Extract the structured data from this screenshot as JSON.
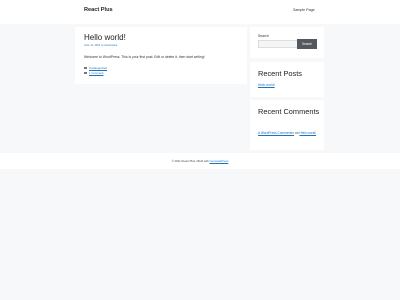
{
  "header": {
    "brand": "React Plus",
    "nav": [
      {
        "label": "Sample Page"
      }
    ]
  },
  "post": {
    "title": "Hello world!",
    "date": "June 11, 2021",
    "by": "by",
    "author": "beoneshoe",
    "body": "Welcome to WordPress. This is your first post. Edit or delete it, then start writing!",
    "category": "Uncategorized",
    "comments_link": "1 Comment"
  },
  "sidebar": {
    "search": {
      "label": "Search",
      "placeholder": "",
      "button": "Search"
    },
    "recent_posts": {
      "title": "Recent Posts",
      "items": [
        "Hello world!"
      ]
    },
    "recent_comments": {
      "title": "Recent Comments",
      "commenter": "A WordPress Commenter",
      "on": "on",
      "post": "Hello world!"
    }
  },
  "footer": {
    "prefix": "© 2021 React Plus • Built with",
    "theme": "GeneratePress"
  }
}
